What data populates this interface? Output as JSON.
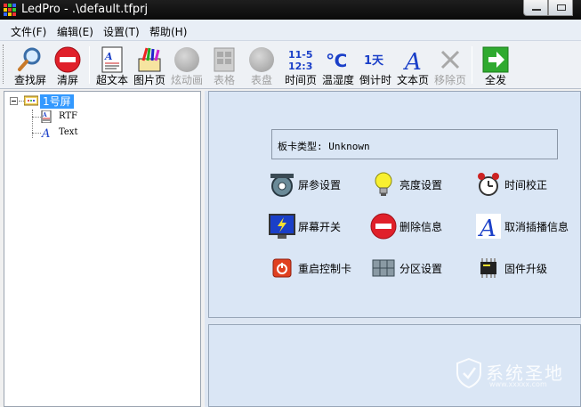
{
  "window": {
    "title": "LedPro - .\\default.tfprj"
  },
  "menu": {
    "items": [
      "文件(F)",
      "编辑(E)",
      "设置(T)",
      "帮助(H)"
    ]
  },
  "toolbar": {
    "buttons": [
      {
        "label": "查找屏",
        "icon": "magnifier-icon",
        "enabled": true
      },
      {
        "label": "清屏",
        "icon": "no-entry-icon",
        "enabled": true
      },
      {
        "label": "超文本",
        "icon": "hypertext-icon",
        "enabled": true
      },
      {
        "label": "图片页",
        "icon": "picture-page-icon",
        "enabled": true
      },
      {
        "label": "炫动画",
        "icon": "animation-icon",
        "enabled": false
      },
      {
        "label": "表格",
        "icon": "table-icon",
        "enabled": false
      },
      {
        "label": "表盘",
        "icon": "dial-icon",
        "enabled": false
      },
      {
        "label": "时间页",
        "icon": "time-page-icon",
        "enabled": true,
        "icon_text": "11-5\n12:3"
      },
      {
        "label": "温湿度",
        "icon": "temperature-icon",
        "enabled": true,
        "icon_text": "℃"
      },
      {
        "label": "倒计时",
        "icon": "countdown-icon",
        "enabled": true,
        "icon_text": "1天"
      },
      {
        "label": "文本页",
        "icon": "text-page-icon",
        "enabled": true,
        "icon_text": "A"
      },
      {
        "label": "移除页",
        "icon": "remove-page-icon",
        "enabled": false
      },
      {
        "label": "全发",
        "icon": "send-all-icon",
        "enabled": true
      }
    ]
  },
  "tree": {
    "root": "1号屏",
    "children": [
      "RTF",
      "Text"
    ]
  },
  "panel": {
    "card_type_label": "板卡类型: Unknown",
    "functions": [
      {
        "label": "屏参设置",
        "icon": "screen-params-icon"
      },
      {
        "label": "亮度设置",
        "icon": "lightbulb-icon"
      },
      {
        "label": "时间校正",
        "icon": "alarm-clock-icon"
      },
      {
        "label": "屏幕开关",
        "icon": "screen-switch-icon"
      },
      {
        "label": "删除信息",
        "icon": "delete-info-icon"
      },
      {
        "label": "取消插播信息",
        "icon": "cancel-insert-icon"
      },
      {
        "label": "重启控制卡",
        "icon": "restart-icon"
      },
      {
        "label": "分区设置",
        "icon": "partition-icon"
      },
      {
        "label": "固件升级",
        "icon": "chip-icon"
      }
    ]
  },
  "watermark": {
    "text": "系统圣地",
    "url": "www.xxxxx.com"
  },
  "colors": {
    "accent_green": "#2faa2f",
    "accent_red": "#e0202a",
    "accent_blue": "#1a3fc8",
    "selection": "#3399ff",
    "panel_bg": "#dae6f5"
  }
}
